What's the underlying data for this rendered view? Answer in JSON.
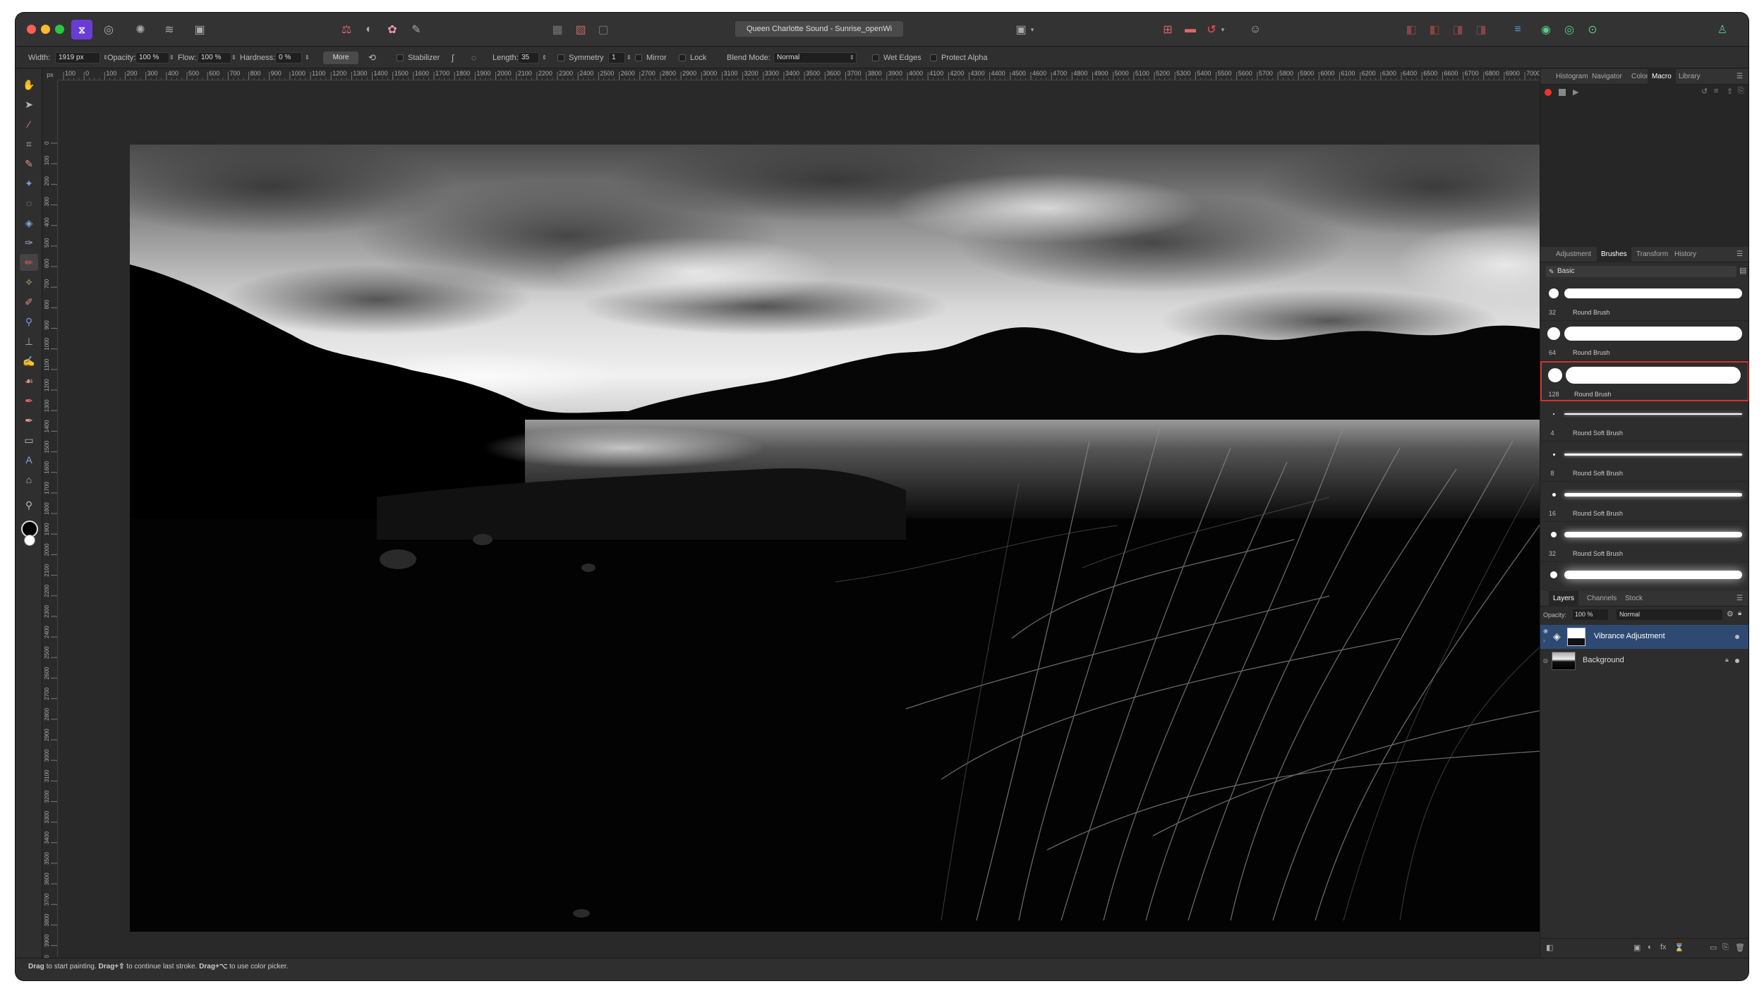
{
  "titlebar": {
    "document_title": "Queen Charlotte Sound - Sunrise_openWi",
    "persona_icons": [
      "affinity-photo-icon",
      "liquify-persona-icon",
      "develop-persona-icon",
      "tone-mapping-persona-icon",
      "export-persona-icon"
    ]
  },
  "context_toolbar": {
    "width_label": "Width:",
    "width_value": "1919 px",
    "opacity_label": "Opacity:",
    "opacity_value": "100 %",
    "flow_label": "Flow:",
    "flow_value": "100 %",
    "hardness_label": "Hardness:",
    "hardness_value": "0 %",
    "more_label": "More",
    "stabilizer_label": "Stabilizer",
    "length_label": "Length:",
    "length_value": "35",
    "symmetry_label": "Symmetry",
    "symmetry_value": "1",
    "mirror_label": "Mirror",
    "lock_label": "Lock",
    "blend_mode_label": "Blend Mode:",
    "blend_mode_value": "Normal",
    "wet_edges_label": "Wet Edges",
    "protect_alpha_label": "Protect Alpha"
  },
  "ruler": {
    "unit": "px",
    "h_ticks": [
      "100",
      "0",
      "100",
      "200",
      "300",
      "400",
      "500",
      "600",
      "700",
      "800",
      "900",
      "1000",
      "1100",
      "1200",
      "1300",
      "1400",
      "1500",
      "1600",
      "1700",
      "1800",
      "1900",
      "2000",
      "2100",
      "2200",
      "2300",
      "2400",
      "2500",
      "2600",
      "2700",
      "2800",
      "2900",
      "3000",
      "3100",
      "3200",
      "3300",
      "3400",
      "3500",
      "3600",
      "3700",
      "3800",
      "3900",
      "4000",
      "4100",
      "4200",
      "4300",
      "4400",
      "4500",
      "4600",
      "4700",
      "4800",
      "4900",
      "5000",
      "5100",
      "5200",
      "5300",
      "5400",
      "5500",
      "5600",
      "5700",
      "5800",
      "5900",
      "6000",
      "6100",
      "6200",
      "6300",
      "6400",
      "6500",
      "6600",
      "6700",
      "6800",
      "6900",
      "7000"
    ],
    "v_ticks": [
      "0",
      "100",
      "200",
      "300",
      "400",
      "500",
      "600",
      "700",
      "800",
      "900",
      "1000",
      "1100",
      "1200",
      "1300",
      "1400",
      "1500",
      "1600",
      "1700",
      "1800",
      "1900",
      "2000",
      "2100",
      "2200",
      "2300",
      "2400",
      "2500",
      "2600",
      "2700",
      "2800",
      "2900",
      "3000",
      "3100",
      "3200",
      "3300",
      "3400",
      "3500",
      "3600",
      "3700",
      "3800",
      "3900",
      "4000"
    ]
  },
  "panels": {
    "top_tabs": [
      "Histogram",
      "Navigator",
      "Color",
      "Macro",
      "Library"
    ],
    "top_active": "Macro",
    "mid_tabs": [
      "Adjustment",
      "Brushes",
      "Transform",
      "History"
    ],
    "mid_active": "Brushes",
    "brush_category": "Basic",
    "brushes": [
      {
        "size": "32",
        "name": "Round Brush"
      },
      {
        "size": "64",
        "name": "Round Brush"
      },
      {
        "size": "128",
        "name": "Round Brush"
      },
      {
        "size": "4",
        "name": "Round Soft Brush"
      },
      {
        "size": "8",
        "name": "Round Soft Brush"
      },
      {
        "size": "16",
        "name": "Round Soft Brush"
      },
      {
        "size": "32",
        "name": "Round Soft Brush"
      },
      {
        "size": "",
        "name": ""
      }
    ],
    "layers_tabs": [
      "Layers",
      "Channels",
      "Stock"
    ],
    "layers_active": "Layers",
    "layers_opacity_label": "Opacity:",
    "layers_opacity_value": "100 %",
    "layers_blend": "Normal",
    "layers": [
      {
        "name": "Vibrance Adjustment"
      },
      {
        "name": "Background"
      }
    ]
  },
  "status": {
    "hint_part1": "Drag",
    "hint_part2": " to start painting. ",
    "hint_part3": "Drag+⇧",
    "hint_part4": " to continue last stroke. ",
    "hint_part5": "Drag+⌥",
    "hint_part6": " to use color picker."
  },
  "colors": {
    "accent": "#6a3cd6",
    "selected_brush_border": "#d0342c",
    "selected_layer": "#2e4a72"
  }
}
